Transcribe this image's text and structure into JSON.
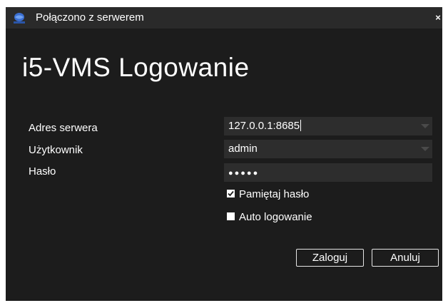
{
  "window": {
    "title": "Połączono z serwerem",
    "close_label": "×",
    "logo_icon": "camera-globe-logo-icon"
  },
  "heading": "i5-VMS Logowanie",
  "form": {
    "server_label": "Adres serwera",
    "server_value": "127.0.0.1:8685",
    "user_label": "Użytkownik",
    "user_value": "admin",
    "password_label": "Hasło",
    "password_mask": "●●●●●",
    "remember_label": "Pamiętaj hasło",
    "remember_checked": true,
    "autologin_label": "Auto logowanie",
    "autologin_checked": false
  },
  "buttons": {
    "login": "Zaloguj",
    "cancel": "Anuluj"
  },
  "colors": {
    "window_bg": "#1c1c1c",
    "titlebar_bg": "#2a2a2a",
    "field_bg": "#2d2d2d",
    "text": "#ffffff"
  }
}
